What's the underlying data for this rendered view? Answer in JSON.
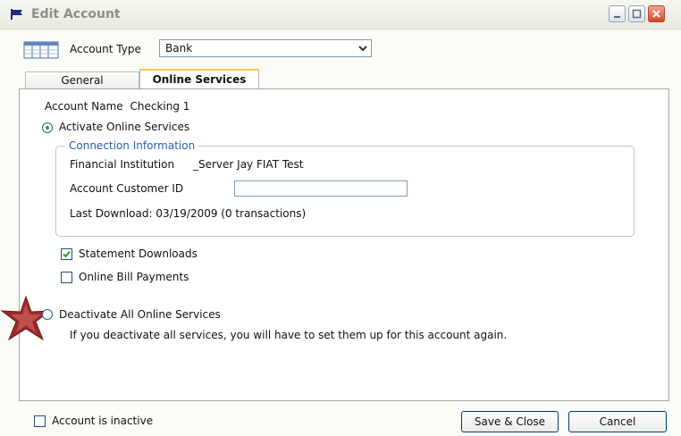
{
  "window": {
    "title": "Edit Account"
  },
  "account_type": {
    "label": "Account Type",
    "value": "Bank"
  },
  "tabs": [
    {
      "label": "General"
    },
    {
      "label": "Online Services"
    }
  ],
  "account_name": {
    "label": "Account Name",
    "value": "Checking 1"
  },
  "activate": {
    "label": "Activate Online Services",
    "selected": true
  },
  "connection": {
    "legend": "Connection Information",
    "fin_inst_label": "Financial Institution",
    "fin_inst_value": "_Server Jay FIAT Test",
    "cust_id_label": "Account Customer ID",
    "cust_id_value": "",
    "last_download": "Last Download: 03/19/2009 (0 transactions)"
  },
  "options": {
    "statement_downloads": {
      "label": "Statement Downloads",
      "checked": true
    },
    "bill_payments": {
      "label": "Online Bill Payments",
      "checked": false
    }
  },
  "deactivate": {
    "label": "Deactivate All Online Services",
    "note": "If you deactivate all services, you will have to set them up for this account again.",
    "selected": false
  },
  "bottom": {
    "inactive_label": "Account is inactive",
    "save_label": "Save & Close",
    "cancel_label": "Cancel"
  },
  "colors": {
    "accent": "#ffc84a",
    "legend": "#2a5db0",
    "close": "#d4482a",
    "star": "#9b2a2a"
  }
}
